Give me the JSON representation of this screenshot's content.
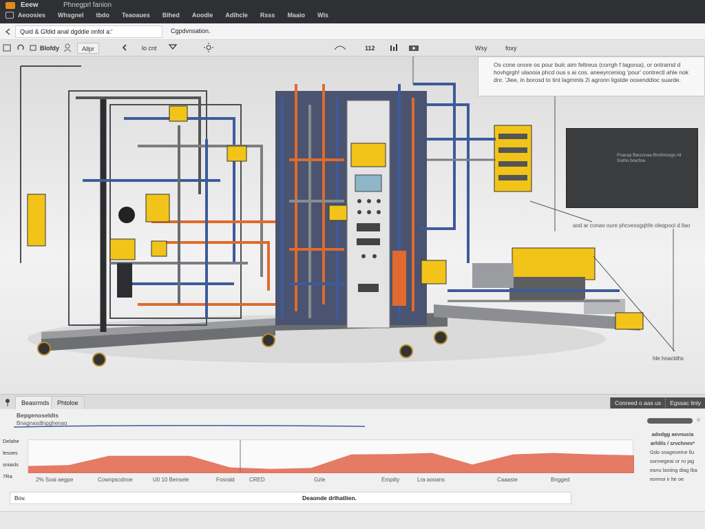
{
  "titlebar": {
    "app_title": "Eeew",
    "doc_title": "Phnegprl fanion"
  },
  "menu": [
    "Aeoosies",
    "Whsgnel",
    "tbdo",
    "Teaoaues",
    "Blhed",
    "Aoodle",
    "Adlhcle",
    "Rsss",
    "Maaio",
    "Wls"
  ],
  "address": {
    "field": "Quid &   Gfdid anal dgddie onfol a:'",
    "right": "Cgpdvnsation."
  },
  "toolbar": {
    "zoom_btn": "Blofdy",
    "view_btn": "Allpr",
    "lo_label": "lo cnt",
    "readout": "112",
    "view_label": "Wsy",
    "fox_label": "foxy"
  },
  "callout": {
    "text": "Os cone onore os pour bulc aim feltreus (corrgh f lagorsa), or ontrarnd d hovhgrgh! ulaooia phcd ous s ai cos. aneeyrceniog 'pour' contrectl ahle nok dnr. 'Jiee, in borosd to tint lagmmls 2i agronn ligstde oosenddioc suarde."
  },
  "screen": {
    "text": "Pcacay ffacccnaa Bnsfrnosgs nil Ssilhs bracfoa",
    "caption": "aod ar conao oure phcvessgqhfe oleqpool d llao"
  },
  "viewport": {
    "bottom_label": "hle hnacldhs"
  },
  "tabs": {
    "left": [
      "Beasrmds",
      "Phtoloe"
    ],
    "right": [
      "Conreed o aas us",
      "Egssac linly"
    ]
  },
  "graph": {
    "title": "Bepgenoseldts",
    "subtitle": "Bnagnasdlnpghenao",
    "y_labels": [
      "Delahe",
      "lesoes",
      "sniasls",
      "7Ra"
    ],
    "x_labels": [
      "2% Soai aegpe",
      "Cownpscdnoe",
      "U0 10 Bensele",
      "Fosrald",
      "CRED",
      "Gzle",
      "Empiity",
      "Lra aooans",
      "Caaaste",
      "Bngged"
    ],
    "footer_left": "Bov.",
    "footer_center": "Deaonde drlhatlien.",
    "side_title": "adxdgg aevnucia",
    "side_sub": "arhlils / srvchnes*",
    "side_items": [
      "Gdo ssageoeine llu",
      "sonnegeai or ro jag",
      "eanu lasting diag lba",
      "eonnoi ir lte oe"
    ]
  },
  "chart_data": {
    "type": "area",
    "x": [
      0,
      1,
      2,
      3,
      4,
      5,
      6,
      7,
      8,
      9,
      10,
      11,
      12,
      13,
      14,
      15
    ],
    "values": [
      0.25,
      0.28,
      0.6,
      0.6,
      0.6,
      0.2,
      0.15,
      0.18,
      0.65,
      0.66,
      0.7,
      0.3,
      0.65,
      0.7,
      0.65,
      0.62
    ],
    "color": "#e0634a"
  },
  "colors": {
    "accent": "#e08a1e",
    "alarm": "#e0634a",
    "machine_yellow": "#f2c419",
    "pipe_blue": "#3d5a9a",
    "pipe_orange": "#e06a2c"
  }
}
